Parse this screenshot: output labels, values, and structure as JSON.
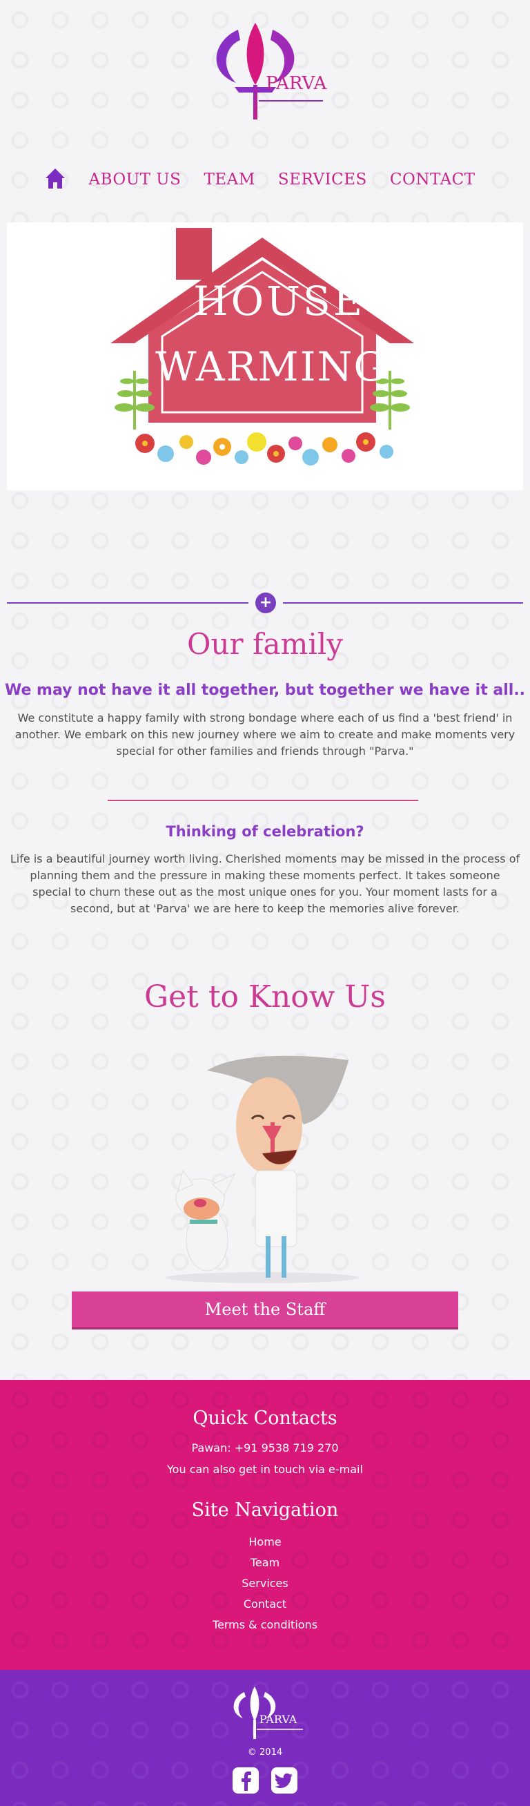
{
  "brand": {
    "name": "PARVA",
    "primary_color": "#cb3a93",
    "secondary_color": "#7b2cbf"
  },
  "nav": {
    "home_icon": "home-icon",
    "items": [
      {
        "label": "ABOUT US"
      },
      {
        "label": "TEAM"
      },
      {
        "label": "SERVICES"
      },
      {
        "label": "CONTACT"
      }
    ]
  },
  "hero": {
    "line1": "HOUSE",
    "line2": "WARMING"
  },
  "family": {
    "title": "Our family",
    "tagline": "We may not have it all together, but together we have it all..",
    "text": "We constitute a happy family with strong bondage where each of us find a 'best friend' in another. We embark on this new journey where we aim to create and make moments very special for other families and friends through \"Parva.\""
  },
  "celebration": {
    "title": "Thinking of celebration?",
    "text": "Life is a beautiful journey worth living. Cherished moments may be missed in the process of planning them and the pressure in making these moments perfect. It takes someone special to churn these out as the most unique ones for you. Your moment lasts for a second, but at 'Parva' we are here to keep the memories alive forever."
  },
  "know_us": {
    "title": "Get to Know Us",
    "button": "Meet the Staff"
  },
  "footer": {
    "contacts_title": "Quick Contacts",
    "phone": "Pawan: +91 9538 719 270",
    "email_note": "You can also get in touch via e-mail",
    "nav_title": "Site Navigation",
    "links": [
      {
        "label": "Home"
      },
      {
        "label": "Team"
      },
      {
        "label": "Services"
      },
      {
        "label": "Contact"
      },
      {
        "label": "Terms & conditions"
      }
    ],
    "logo_text": "PARVA",
    "copyright": "© 2014",
    "social": [
      "facebook-icon",
      "twitter-icon"
    ]
  }
}
